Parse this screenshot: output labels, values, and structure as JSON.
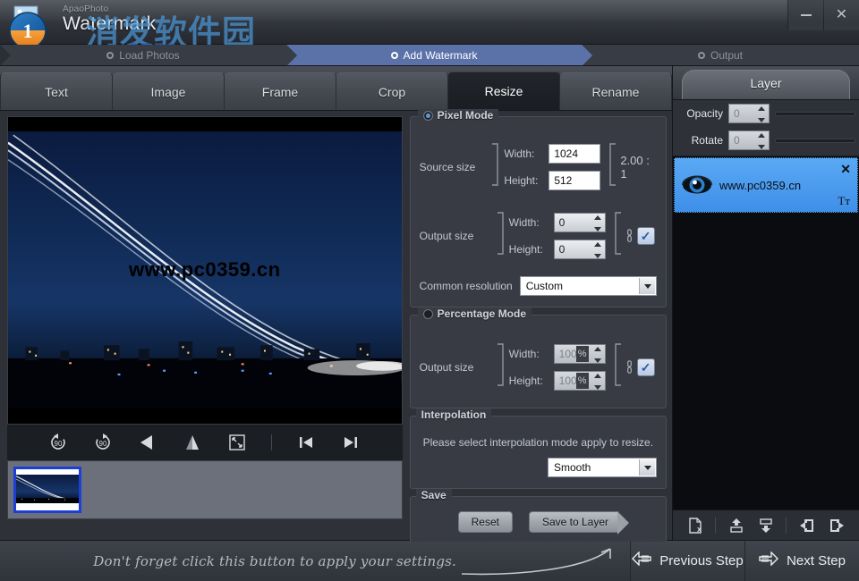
{
  "window": {
    "app_subtitle": "ApaoPhoto",
    "app_title": "Watermark",
    "minimize_label": "Minimize",
    "close_label": "✕",
    "watermark_overlay_cn": "消发软件园",
    "watermark_overlay_url_www": "www.",
    "watermark_overlay_url_mid": "pc0359",
    "watermark_overlay_url_end": ".cn"
  },
  "steps": [
    {
      "label": "Load Photos",
      "state": "done"
    },
    {
      "label": "Add Watermark",
      "state": "active"
    },
    {
      "label": "Output",
      "state": "pending"
    }
  ],
  "tabs": [
    {
      "label": "Text",
      "active": false
    },
    {
      "label": "Image",
      "active": false
    },
    {
      "label": "Frame",
      "active": false
    },
    {
      "label": "Crop",
      "active": false
    },
    {
      "label": "Resize",
      "active": true
    },
    {
      "label": "Rename",
      "active": false
    }
  ],
  "preview": {
    "watermark_text": "www.pc0359.cn",
    "toolbar": [
      {
        "name": "rotate-left-90",
        "label": "90"
      },
      {
        "name": "rotate-right-90",
        "label": "90"
      },
      {
        "name": "flip-horizontal",
        "label": ""
      },
      {
        "name": "flip-vertical",
        "label": ""
      },
      {
        "name": "fit-to-screen",
        "label": ""
      },
      {
        "name": "previous-image",
        "label": ""
      },
      {
        "name": "next-image",
        "label": ""
      }
    ]
  },
  "pixel_mode": {
    "legend": "Pixel Mode",
    "selected": true,
    "source_size_label": "Source size",
    "source_width_label": "Width:",
    "source_width_value": "1024",
    "source_height_label": "Height:",
    "source_height_value": "512",
    "ratio": "2.00 : 1",
    "output_size_label": "Output size",
    "output_width_label": "Width:",
    "output_width_value": "0",
    "output_height_label": "Height:",
    "output_height_value": "0",
    "keep_ratio_checked": "✓",
    "common_resolution_label": "Common resolution",
    "common_resolution_value": "Custom"
  },
  "percentage_mode": {
    "legend": "Percentage Mode",
    "selected": false,
    "output_size_label": "Output size",
    "width_label": "Width:",
    "width_value": "100",
    "height_label": "Height:",
    "height_value": "100",
    "percent_symbol": "%",
    "keep_ratio_checked": "✓"
  },
  "interpolation": {
    "legend": "Interpolation",
    "description": "Please select interpolation mode apply to resize.",
    "value": "Smooth"
  },
  "save": {
    "legend": "Save",
    "reset_label": "Reset",
    "save_to_layer_label": "Save to Layer"
  },
  "layer_panel": {
    "title": "Layer",
    "opacity_label": "Opacity",
    "opacity_value": "0",
    "rotate_label": "Rotate",
    "rotate_value": "0",
    "items": [
      {
        "name": "www.pc0359.cn",
        "close": "✕",
        "type_glyph": "Tт"
      }
    ],
    "footer_buttons": [
      {
        "name": "delete-layer-icon"
      },
      {
        "name": "move-layer-up-icon"
      },
      {
        "name": "move-layer-down-icon"
      },
      {
        "name": "import-layer-icon"
      },
      {
        "name": "export-layer-icon"
      }
    ]
  },
  "bottom_bar": {
    "hint": "Don't forget click this button to apply your settings.",
    "previous_label": "Previous Step",
    "next_label": "Next Step"
  },
  "colors": {
    "accent_blue": "#5a72a8",
    "layer_selected": "#3e8fe8",
    "panel_bg": "#383b44",
    "window_bg": "#2e3138"
  }
}
